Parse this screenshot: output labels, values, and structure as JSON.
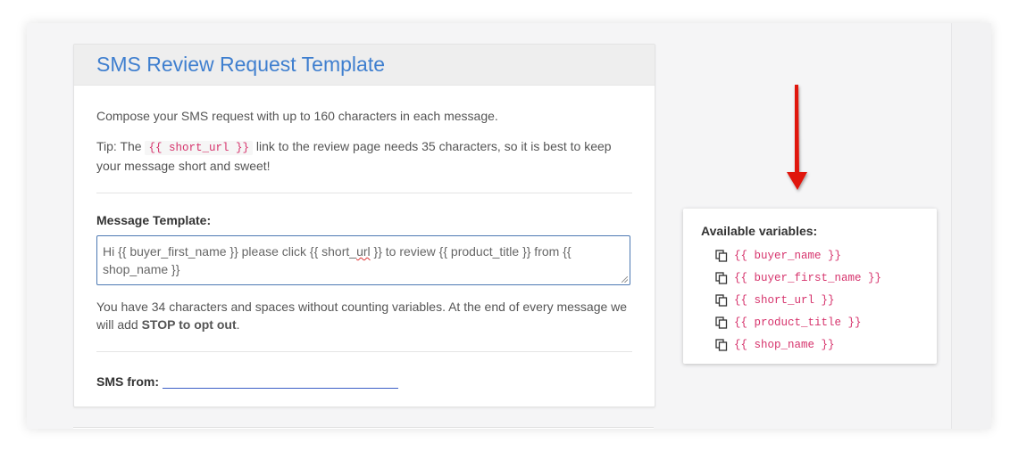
{
  "panel": {
    "title": "SMS Review Request Template",
    "intro": "Compose your SMS request with up to 160 characters in each message.",
    "tip_prefix": "Tip: The ",
    "tip_var": "{{ short_url }}",
    "tip_suffix": " link to the review page needs 35 characters, so it is best to keep your message short and sweet!",
    "template_label": "Message Template:",
    "template_value_pre": "Hi {{ buyer_first_name }} please click {{ short_",
    "template_value_spell": "url",
    "template_value_post": " }} to review {{ product_title }} from {{ shop_name }}",
    "count_text": "You have 34 characters and spaces without counting variables. At the end of every message we will add ",
    "count_bold": "STOP to opt out",
    "count_end": ".",
    "sms_from_label": "SMS from:",
    "sms_from_value": ""
  },
  "variables": {
    "title": "Available variables:",
    "items": [
      {
        "label": "{{ buyer_name }}",
        "icon": "copy-icon"
      },
      {
        "label": "{{ buyer_first_name }}",
        "icon": "copy-icon"
      },
      {
        "label": "{{ short_url }}",
        "icon": "copy-icon"
      },
      {
        "label": "{{ product_title }}",
        "icon": "copy-icon"
      },
      {
        "label": "{{ shop_name }}",
        "icon": "copy-icon"
      }
    ]
  },
  "colors": {
    "accent": "#3f7fcf",
    "variable": "#d6336c",
    "arrow": "#e0140f"
  }
}
